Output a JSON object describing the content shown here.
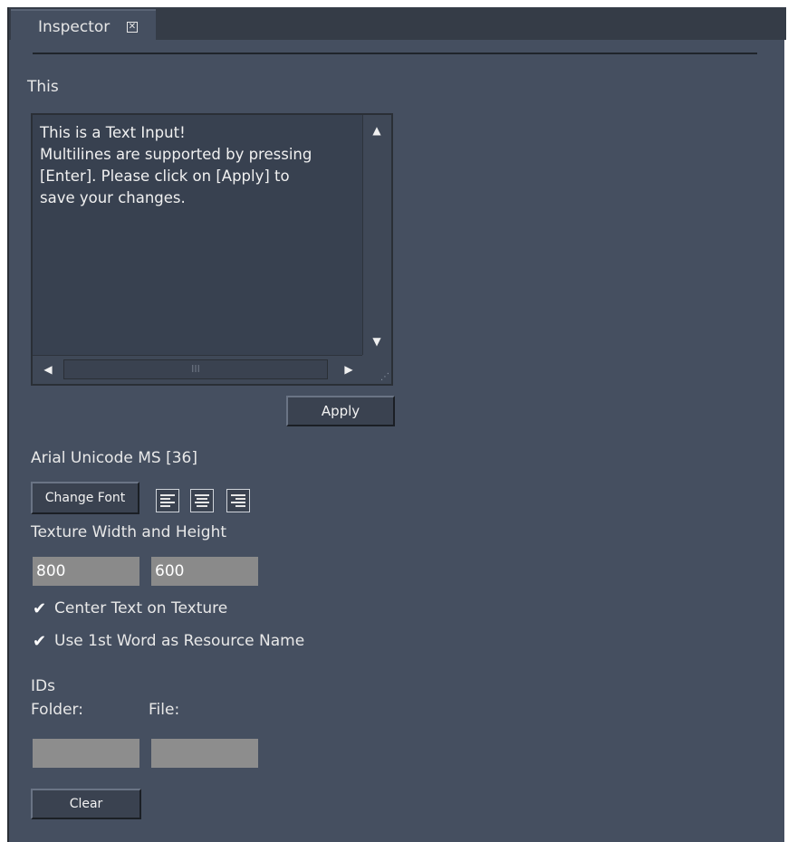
{
  "tab": {
    "title": "Inspector",
    "close_icon": "close-box-icon"
  },
  "section": {
    "title": "This"
  },
  "text_input": {
    "value": "This is a Text Input!\nMultilines are supported by pressing\n[Enter]. Please click on [Apply] to\nsave your changes.",
    "scroll_up_icon": "triangle-up-icon",
    "scroll_down_icon": "triangle-down-icon",
    "scroll_left_icon": "triangle-left-icon",
    "scroll_right_icon": "triangle-right-icon",
    "thumb_grip": "III"
  },
  "apply_label": "Apply",
  "font": {
    "label": "Arial Unicode MS [36]",
    "change_font_label": "Change Font",
    "align_left_icon": "align-left-icon",
    "align_center_icon": "align-center-icon",
    "align_right_icon": "align-right-icon"
  },
  "texture": {
    "label": "Texture Width and Height",
    "width": "800",
    "height": "600"
  },
  "options": {
    "center_text_label": "Center Text on Texture",
    "center_text_checked": true,
    "use_first_word_label": "Use 1st Word as Resource Name",
    "use_first_word_checked": true
  },
  "ids": {
    "label": "IDs",
    "folder_label": "Folder:",
    "file_label": "File:",
    "folder_value": "",
    "file_value": ""
  },
  "clear_label": "Clear"
}
